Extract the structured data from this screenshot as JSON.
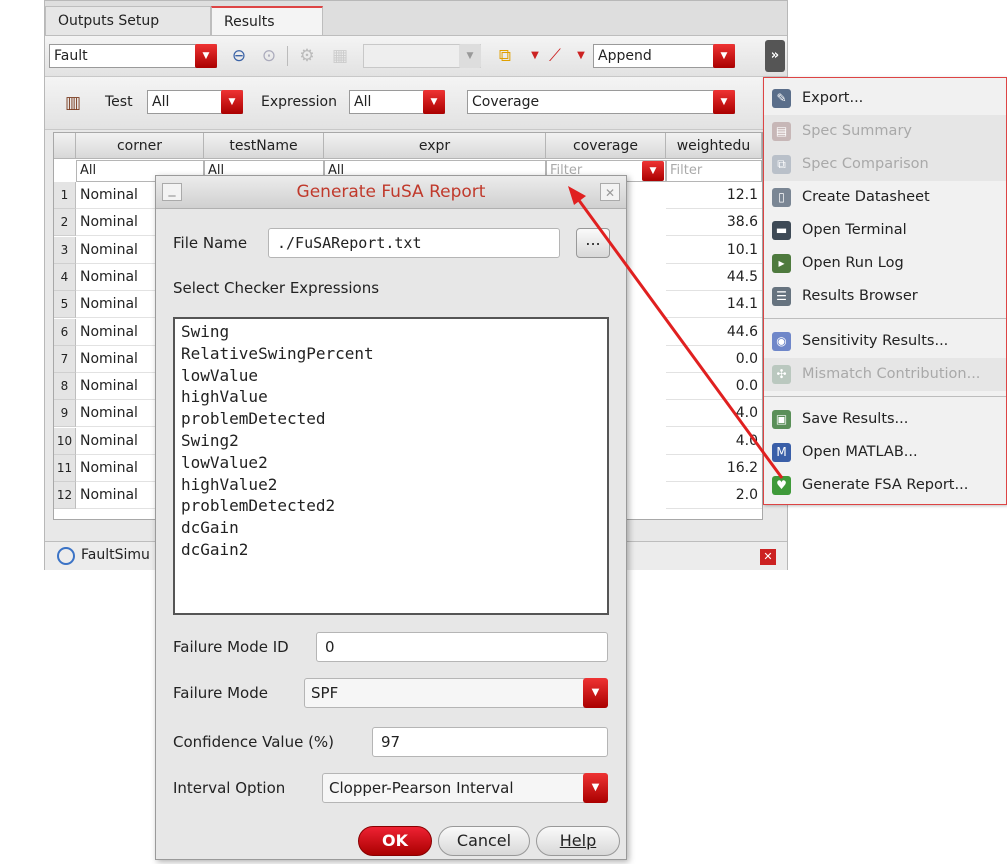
{
  "tabs": [
    "Outputs Setup",
    "Results"
  ],
  "toolbar1": {
    "fault_select": "Fault",
    "append_select": "Append",
    "overflow": "»"
  },
  "toolbar2": {
    "test_label": "Test",
    "test_value": "All",
    "expression_label": "Expression",
    "expression_value": "All",
    "view_select": "Coverage"
  },
  "grid": {
    "columns": [
      "corner",
      "testName",
      "expr",
      "coverage",
      "weightedu"
    ],
    "filters": [
      "All",
      "All",
      "All",
      "Filter",
      "Filter"
    ],
    "rows": [
      {
        "n": "1",
        "corner": "Nominal",
        "w": "12.1"
      },
      {
        "n": "2",
        "corner": "Nominal",
        "w": "38.6"
      },
      {
        "n": "3",
        "corner": "Nominal",
        "w": "10.1"
      },
      {
        "n": "4",
        "corner": "Nominal",
        "w": "44.5"
      },
      {
        "n": "5",
        "corner": "Nominal",
        "w": "14.1"
      },
      {
        "n": "6",
        "corner": "Nominal",
        "w": "44.6"
      },
      {
        "n": "7",
        "corner": "Nominal",
        "w": "0.0"
      },
      {
        "n": "8",
        "corner": "Nominal",
        "w": "0.0"
      },
      {
        "n": "9",
        "corner": "Nominal",
        "w": "4.0"
      },
      {
        "n": "10",
        "corner": "Nominal",
        "w": "4.0"
      },
      {
        "n": "11",
        "corner": "Nominal",
        "w": "16.2"
      },
      {
        "n": "12",
        "corner": "Nominal",
        "w": "2.0"
      }
    ]
  },
  "statusbar": {
    "item": "FaultSimu"
  },
  "menu": {
    "items": [
      {
        "label": "Export...",
        "disabled": false,
        "color": "#5a6e8a",
        "icon": "✎"
      },
      {
        "label": "Spec Summary",
        "disabled": true,
        "color": "#c7b7b7",
        "icon": "▤"
      },
      {
        "label": "Spec Comparison",
        "disabled": true,
        "color": "#b9c0c9",
        "icon": "⧉"
      },
      {
        "label": "Create Datasheet",
        "disabled": false,
        "color": "#7a8694",
        "icon": "▯"
      },
      {
        "label": "Open Terminal",
        "disabled": false,
        "color": "#3e4a56",
        "icon": "▬"
      },
      {
        "label": "Open Run Log",
        "disabled": false,
        "color": "#4e7a3e",
        "icon": "▸"
      },
      {
        "label": "Results Browser",
        "disabled": false,
        "color": "#66737f",
        "icon": "☰"
      },
      {
        "label": "Sensitivity Results...",
        "disabled": false,
        "color": "#6f87c9",
        "icon": "◉"
      },
      {
        "label": "Mismatch Contribution...",
        "disabled": true,
        "color": "#bac8bf",
        "icon": "✣"
      },
      {
        "label": "Save Results...",
        "disabled": false,
        "color": "#5a8f58",
        "icon": "▣"
      },
      {
        "label": "Open MATLAB...",
        "disabled": false,
        "color": "#3a5fa8",
        "icon": "M"
      },
      {
        "label": "Generate FSA Report...",
        "disabled": false,
        "color": "#3f9a3a",
        "icon": "♥"
      }
    ]
  },
  "dialog": {
    "title": "Generate FuSA Report",
    "file_name_label": "File Name",
    "file_name_value": "./FuSAReport.txt",
    "browse_label": "...",
    "checker_label": "Select Checker Expressions",
    "expressions": [
      "Swing",
      "RelativeSwingPercent",
      "lowValue",
      "highValue",
      "problemDetected",
      "Swing2",
      "lowValue2",
      "highValue2",
      "problemDetected2",
      "dcGain",
      "dcGain2"
    ],
    "failure_mode_id_label": "Failure Mode ID",
    "failure_mode_id_value": "0",
    "failure_mode_label": "Failure Mode",
    "failure_mode_value": "SPF",
    "confidence_label": "Confidence Value (%)",
    "confidence_value": "97",
    "interval_label": "Interval Option",
    "interval_value": "Clopper-Pearson Interval",
    "ok": "OK",
    "cancel": "Cancel",
    "help": "Help"
  },
  "colors": {
    "accent_red": "#c0392b",
    "arrow": "#e02020"
  }
}
